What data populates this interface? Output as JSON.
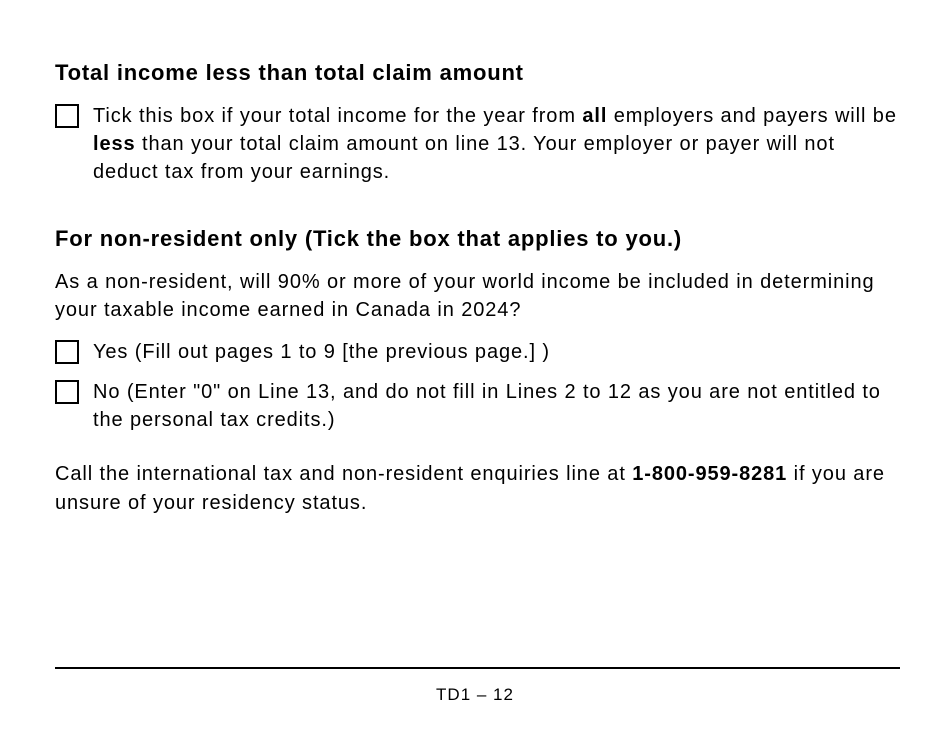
{
  "section1": {
    "heading": "Total income less than total claim amount",
    "checkbox_text_parts": {
      "pre_all": "Tick this box if your total income for the year from ",
      "all": "all",
      "mid": " employers and payers will be ",
      "less": "less",
      "post": " than your total claim amount on line 13. Your employer or payer will not deduct tax from your earnings."
    }
  },
  "section2": {
    "heading": "For non-resident only (Tick the box that applies to you.)",
    "intro": "As a non-resident, will 90% or more of your world income be included in determining your taxable income earned in Canada in 2024?",
    "option_yes": "Yes (Fill out pages 1 to 9 [the previous page.] )",
    "option_no": "No (Enter \"0\" on Line 13, and do not fill in Lines 2 to 12 as you are not entitled to the personal tax credits.)",
    "call_pre": "Call the international tax and non-resident enquiries line at ",
    "call_phone": "1-800-959-8281",
    "call_post": " if you are unsure of your residency status."
  },
  "footer": {
    "page": "TD1 – 12"
  }
}
